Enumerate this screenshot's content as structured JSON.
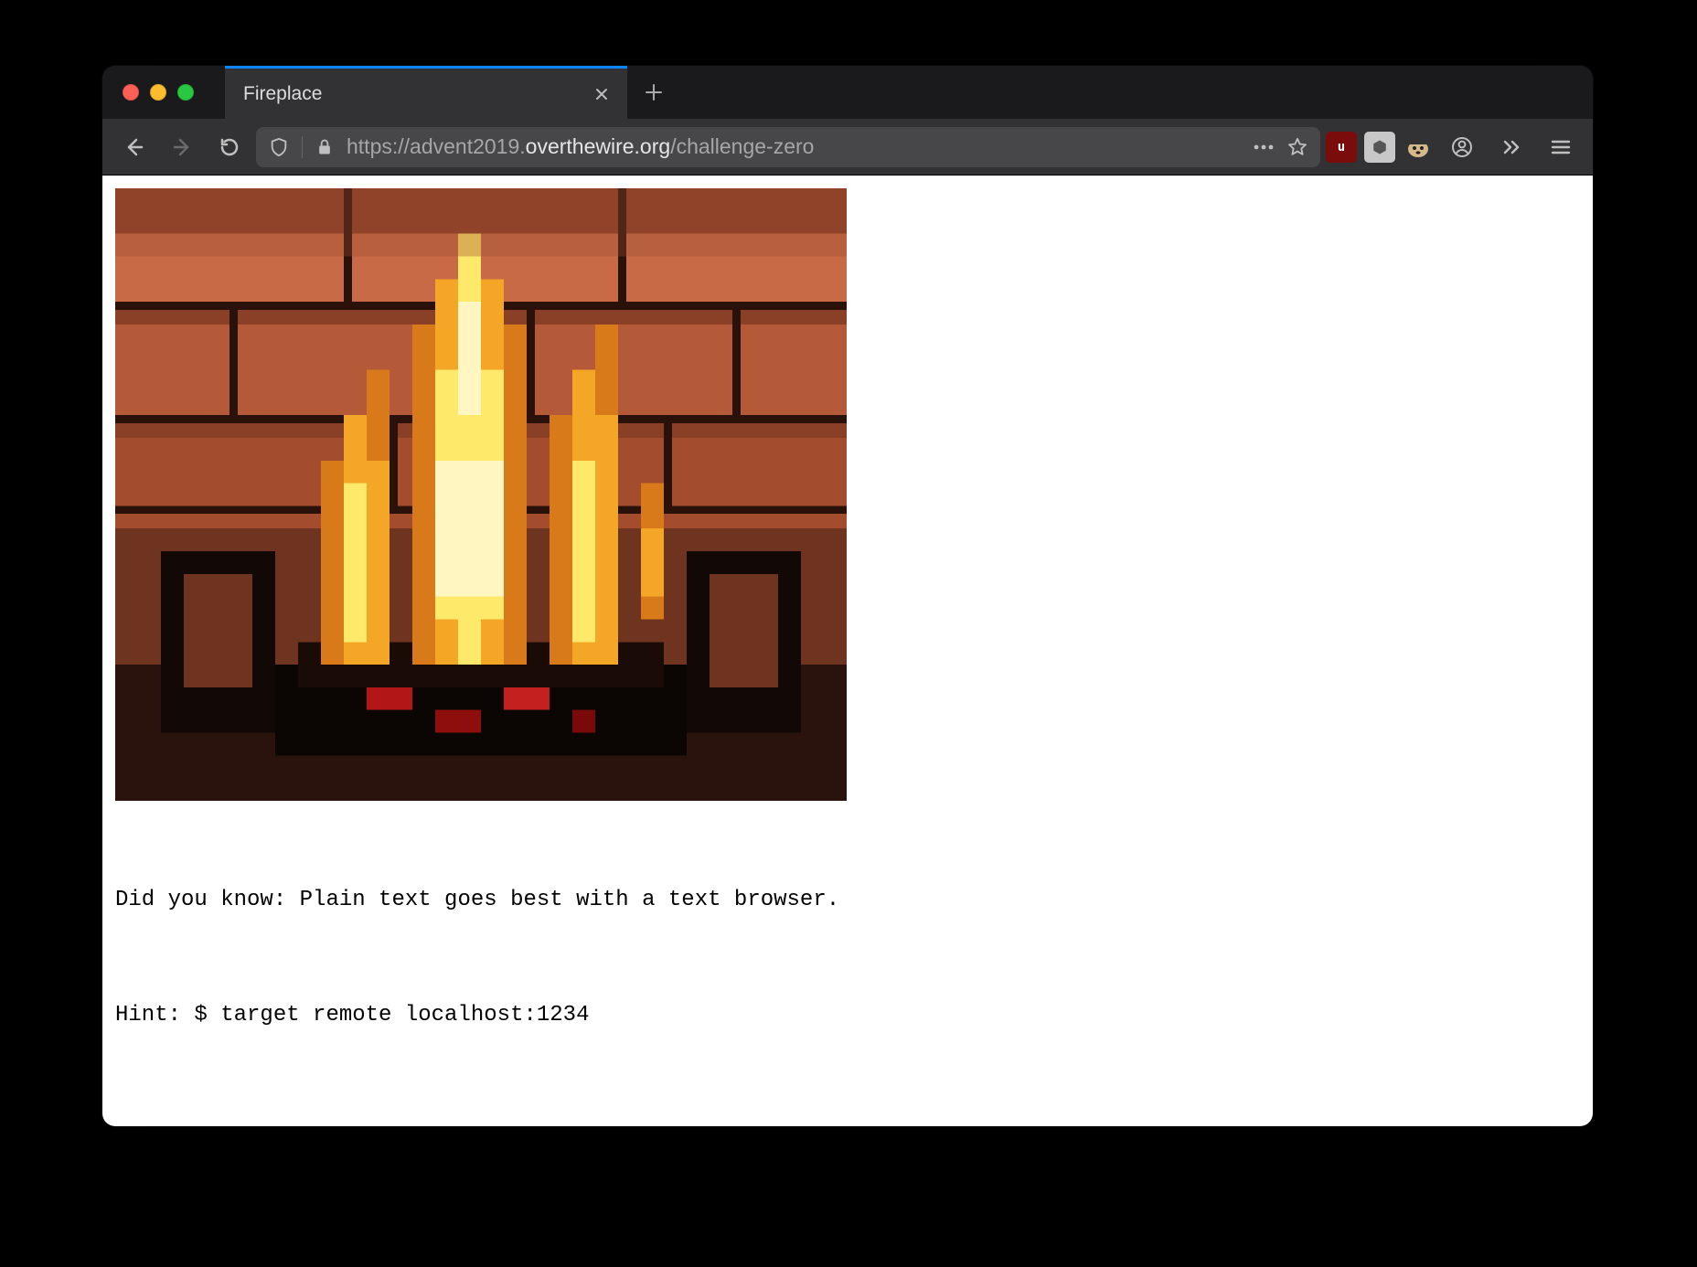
{
  "browser": {
    "tab_title": "Fireplace",
    "url_prefix": "https://advent2019.",
    "url_domain": "overthewire.org",
    "url_suffix": "/challenge-zero",
    "extensions": {
      "ubadge": "u"
    }
  },
  "page": {
    "image_alt": "fireplace-pixel-art",
    "line1": "Did you know: Plain text goes best with a text browser.",
    "line2": "Hint: $ target remote localhost:1234"
  }
}
